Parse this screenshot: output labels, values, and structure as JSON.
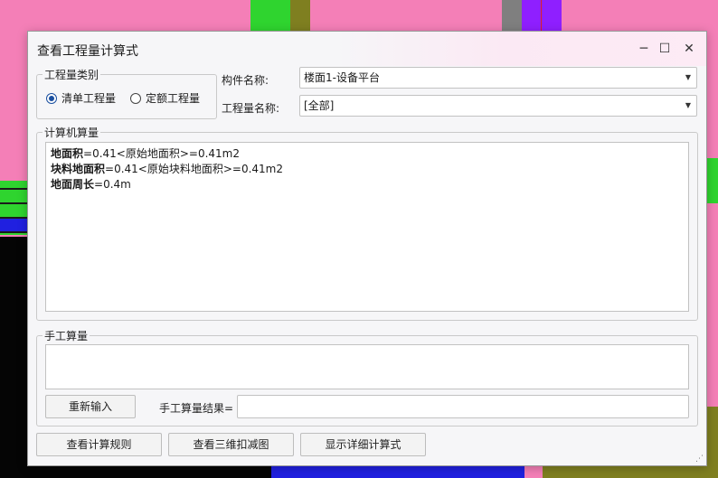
{
  "window": {
    "title": "查看工程量计算式",
    "minimize_symbol": "─",
    "maximize_symbol": "☐",
    "close_symbol": "✕"
  },
  "quantity_type": {
    "legend": "工程量类别",
    "options": [
      {
        "label": "清单工程量",
        "selected": true
      },
      {
        "label": "定额工程量",
        "selected": false
      }
    ]
  },
  "component": {
    "label": "构件名称:",
    "value": "楼面1-设备平台"
  },
  "quantity_name": {
    "label": "工程量名称:",
    "value": "[全部]"
  },
  "computer_calc": {
    "legend": "计算机算量",
    "lines": [
      {
        "key": "地面积",
        "expr": "=0.41<原始地面积>=0.41m2"
      },
      {
        "key": "块料地面积",
        "expr": "=0.41<原始块料地面积>=0.41m2"
      },
      {
        "key": "地面周长",
        "expr": "=0.4m"
      }
    ]
  },
  "manual_calc": {
    "legend": "手工算量",
    "reenter_button": "重新输入",
    "result_label": "手工算量结果=",
    "result_value": ""
  },
  "footer": {
    "rules_button": "查看计算规则",
    "view3d_button": "查看三维扣减图",
    "detail_button": "显示详细计算式"
  },
  "dropdown_arrow": "▼"
}
